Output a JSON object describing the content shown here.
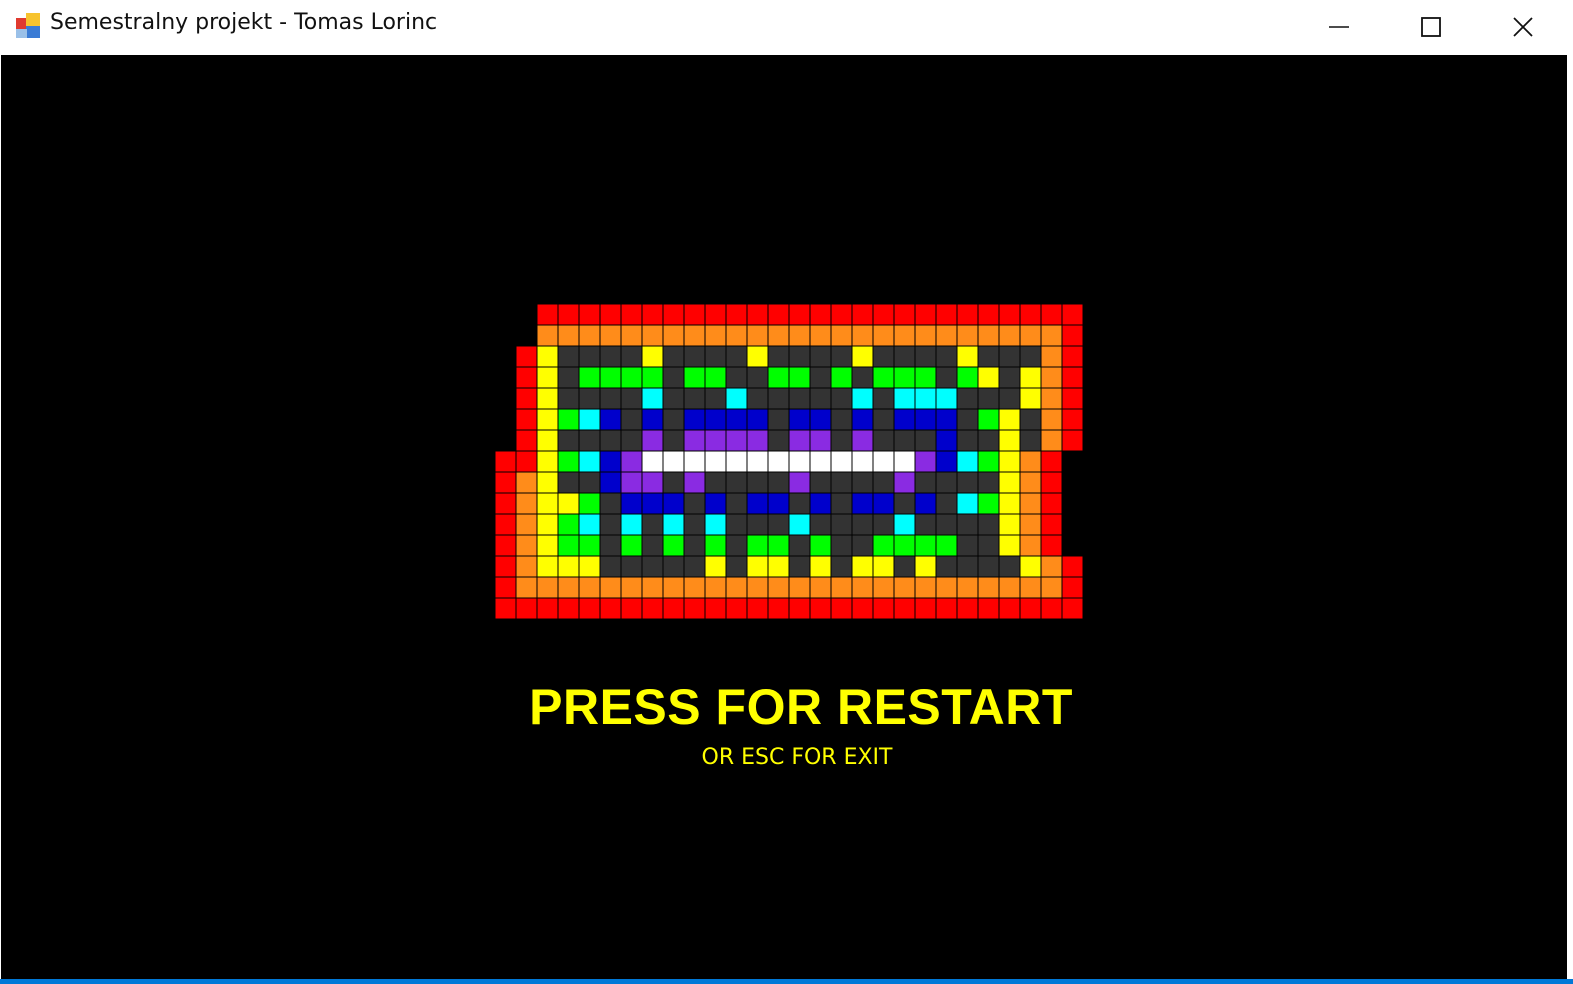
{
  "window": {
    "title": "Semestralny projekt - Tomas Lorinc",
    "controls": [
      "minimize",
      "maximize",
      "close"
    ]
  },
  "game": {
    "message": "PRESS FOR RESTART",
    "submessage": "OR ESC FOR EXIT",
    "colors": {
      "background": "#000000",
      "text": "#ffff00",
      "R": "#ff0000",
      "O": "#ff8c1a",
      "Y": "#ffff00",
      "G": "#00ff00",
      "C": "#00ffff",
      "B": "#0000cc",
      "P": "#8a2be2",
      "W": "#ffffff",
      "D": "#333333",
      "grid": "#000000"
    },
    "board": [
      "..RRRRRRRRRRRRRRRRRRRRRRRRRR",
      "..OOOOOOOOOOOOOOOOOOOOOOOOOR",
      ".RYDDDDYDDDDYDDDDYDDDDYDDDOR",
      ".RYDGGGGDGGDDGGDGDGGGDGYDYOR",
      ".RYDDDDCDDDCDDDDDCDCCCDDDYOR",
      ".RYGCBDBDBBBBDBBDBDBBBDGYDOR",
      ".RYDDDDPDPPPPDPPDPDDDBDDYDOR",
      "RRYGCBPWWWWWWWWWWWWWPBCGYOR",
      "ROYDDBPPDPDDDDPDDDDPDDDDYOR",
      "ROYYGDBBBDBDBBDBDBBDBDCGYOR",
      "ROYGCDCDCDCDDDCDDDDCDDDDYOR",
      "ROYGGDGDGDGDGGDGDDGGGGDDYOR",
      "ROYYYDDDDDYDYYDYDYYDYDDDDYOR",
      "ROOOOOOOOOOOOOOOOOOOOOOOOOOR",
      "RRRRRRRRRRRRRRRRRRRRRRRRRRRR"
    ]
  }
}
